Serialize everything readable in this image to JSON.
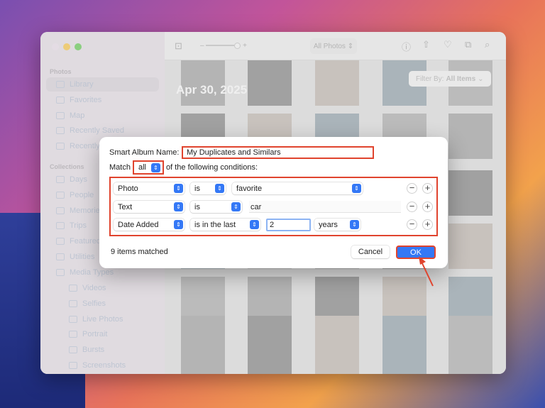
{
  "window": {
    "toolbar": {
      "view_selector": "All Photos",
      "icons": [
        "aspect-icon",
        "info-icon",
        "share-icon",
        "heart-icon",
        "rotate-icon",
        "search-icon"
      ]
    },
    "date_header": "Apr 30, 2025",
    "filter": {
      "label": "Filter By:",
      "value": "All Items"
    },
    "sidebar": {
      "photos_header": "Photos",
      "photos_items": [
        {
          "label": "Library"
        },
        {
          "label": "Favorites"
        },
        {
          "label": "Map"
        },
        {
          "label": "Recently Saved"
        },
        {
          "label": "Recently Deleted"
        }
      ],
      "collections_header": "Collections",
      "collections_items": [
        {
          "label": "Days"
        },
        {
          "label": "People"
        },
        {
          "label": "Memories"
        },
        {
          "label": "Trips"
        },
        {
          "label": "Featured Photos"
        },
        {
          "label": "Utilities"
        },
        {
          "label": "Media Types"
        }
      ],
      "media_items": [
        {
          "label": "Videos"
        },
        {
          "label": "Selfies"
        },
        {
          "label": "Live Photos"
        },
        {
          "label": "Portrait"
        },
        {
          "label": "Bursts"
        },
        {
          "label": "Screenshots"
        }
      ]
    }
  },
  "dialog": {
    "name_label": "Smart Album Name:",
    "name_value": "My Duplicates and Similars",
    "match_label": "Match",
    "match_value": "all",
    "match_suffix": "of the following conditions:",
    "conditions": [
      {
        "field": "Photo",
        "operator": "is",
        "value": "favorite"
      },
      {
        "field": "Text",
        "operator": "is",
        "value": "car"
      },
      {
        "field": "Date Added",
        "operator": "is in the last",
        "value": "2",
        "unit": "years"
      }
    ],
    "status": "9 items matched",
    "cancel": "Cancel",
    "ok": "OK",
    "accent": "#3478f6",
    "highlight": "#e0442e"
  }
}
